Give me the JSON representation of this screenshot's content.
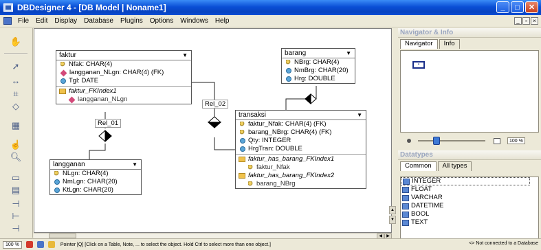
{
  "window": {
    "title": "DBDesigner 4 - [DB Model | Noname1]",
    "min": "_",
    "max": "□",
    "close": "✕"
  },
  "menu": [
    "File",
    "Edit",
    "Display",
    "Database",
    "Plugins",
    "Options",
    "Windows",
    "Help"
  ],
  "menu_accel": [
    "F",
    "E",
    "D",
    "a",
    "P",
    "O",
    "W",
    "H"
  ],
  "mdi": [
    "_",
    "▫",
    "×"
  ],
  "entities": {
    "faktur": {
      "name": "faktur",
      "rows": [
        {
          "icon": "key-icon",
          "text": "Nfak: CHAR(4)"
        },
        {
          "icon": "fk-icon",
          "text": "langganan_NLgn: CHAR(4) (FK)"
        },
        {
          "icon": "attribute-icon",
          "text": "Tgl: DATE"
        }
      ],
      "indexes": [
        {
          "name": "faktur_FKIndex1",
          "cols": [
            "langganan_NLgn"
          ]
        }
      ]
    },
    "barang": {
      "name": "barang",
      "rows": [
        {
          "icon": "key-icon",
          "text": "NBrg: CHAR(4)"
        },
        {
          "icon": "attribute-icon",
          "text": "NmBrg: CHAR(20)"
        },
        {
          "icon": "attribute-icon",
          "text": "Hrg: DOUBLE"
        }
      ]
    },
    "transaksi": {
      "name": "transaksi",
      "rows": [
        {
          "icon": "key-icon",
          "text": "faktur_Nfak: CHAR(4) (FK)"
        },
        {
          "icon": "key-icon",
          "text": "barang_NBrg: CHAR(4) (FK)"
        },
        {
          "icon": "attribute-icon",
          "text": "Qty: INTEGER"
        },
        {
          "icon": "attribute-icon",
          "text": "HrgTran: DOUBLE"
        }
      ],
      "indexes": [
        {
          "name": "faktur_has_barang_FKIndex1",
          "cols": [
            "faktur_Nfak"
          ]
        },
        {
          "name": "faktur_has_barang_FKIndex2",
          "cols": [
            "barang_NBrg"
          ]
        }
      ]
    },
    "langganan": {
      "name": "langganan",
      "rows": [
        {
          "icon": "key-icon",
          "text": "NLgn: CHAR(4)"
        },
        {
          "icon": "attribute-icon",
          "text": "NmLgn: CHAR(20)"
        },
        {
          "icon": "attribute-icon",
          "text": "KtLgn: CHAR(20)"
        }
      ]
    }
  },
  "relations": {
    "rel01": "Rel_01",
    "rel02": "Rel_02"
  },
  "navigator": {
    "title": "Navigator & Info",
    "tabs": [
      "Navigator",
      "Info"
    ],
    "zoom": "100 %"
  },
  "datatypes": {
    "title": "Datatypes",
    "tabs": [
      "Common",
      "All types"
    ],
    "items": [
      "INTEGER",
      "FLOAT",
      "VARCHAR",
      "DATETIME",
      "BOOL",
      "TEXT"
    ],
    "selected": "INTEGER"
  },
  "status": {
    "zoom": "100 %",
    "message": "Pointer [Q] [Click on a Table, Note, ... to select the object. Hold Ctrl to select more than one object.]",
    "connection": "<> Not connected to a Database"
  },
  "colors": {
    "titlebar": "#0a4fd6",
    "panel": "#ece9d8",
    "canvas": "#ffffff"
  }
}
